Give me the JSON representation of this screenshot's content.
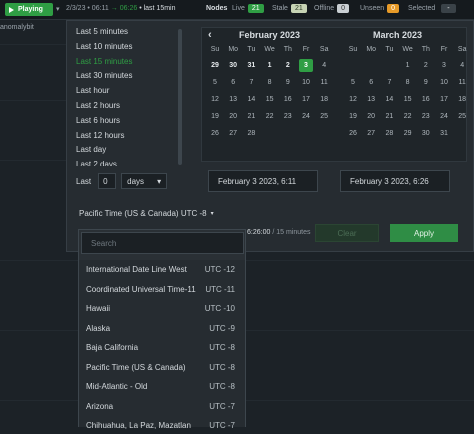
{
  "topbar": {
    "play_label": "Playing",
    "range_start": "2/3/23 • 06:11",
    "arrow": "→",
    "range_end": "06:26",
    "range_suffix": "• last 15min",
    "nodes_label": "Nodes",
    "live_label": "Live",
    "live_count": "21",
    "stale_label": "Stale",
    "stale_count": "21",
    "offline_label": "Offline",
    "offline_count": "0",
    "unseen_label": "Unseen",
    "unseen_count": "0",
    "selected_label": "Selected",
    "selected_count": "-",
    "colors": {
      "live": "#2f9e44",
      "stale": "#7a8a6a",
      "offline": "#6b747b",
      "unseen": "#e69a28"
    }
  },
  "left_strip": {
    "label": "anomalybit"
  },
  "quick_ranges": [
    "Last 5 minutes",
    "Last 10 minutes",
    "Last 15 minutes",
    "Last 30 minutes",
    "Last hour",
    "Last 2 hours",
    "Last 6 hours",
    "Last 12 hours",
    "Last day",
    "Last 2 days"
  ],
  "active_quick_range_index": 2,
  "custom_last": {
    "label": "Last",
    "value": "0",
    "unit": "days",
    "caret": "▾"
  },
  "timezone": {
    "selected": "Pacific Time (US & Canada) UTC -8",
    "caret": "▾"
  },
  "calendar_left": {
    "title": "February 2023",
    "prev_icon": "‹",
    "days_of_week": [
      "Su",
      "Mo",
      "Tu",
      "We",
      "Th",
      "Fr",
      "Sa"
    ],
    "weeks": [
      [
        "29",
        "30",
        "31",
        "1",
        "2",
        "3",
        "4"
      ],
      [
        "5",
        "6",
        "7",
        "8",
        "9",
        "10",
        "11"
      ],
      [
        "12",
        "13",
        "14",
        "15",
        "16",
        "17",
        "18"
      ],
      [
        "19",
        "20",
        "21",
        "22",
        "23",
        "24",
        "25"
      ],
      [
        "26",
        "27",
        "28",
        "",
        "",
        "",
        ""
      ]
    ],
    "selected_day": "3"
  },
  "calendar_right": {
    "title": "March 2023",
    "days_of_week": [
      "Su",
      "Mo",
      "Tu",
      "We",
      "Th",
      "Fr",
      "Sa"
    ],
    "weeks": [
      [
        "",
        "",
        "",
        "1",
        "2",
        "3",
        "4"
      ],
      [
        "5",
        "6",
        "7",
        "8",
        "9",
        "10",
        "11"
      ],
      [
        "12",
        "13",
        "14",
        "15",
        "16",
        "17",
        "18"
      ],
      [
        "19",
        "20",
        "21",
        "22",
        "23",
        "24",
        "25"
      ],
      [
        "26",
        "27",
        "28",
        "29",
        "30",
        "31",
        ""
      ]
    ]
  },
  "start_datetime": "February 3 2023, 6:11",
  "end_datetime": "February 3 2023, 6:26",
  "duration": {
    "time": "6:26:00",
    "separator": "/",
    "span": "15 minutes"
  },
  "buttons": {
    "clear": "Clear",
    "apply": "Apply"
  },
  "tz_dropdown": {
    "search_placeholder": "Search",
    "options": [
      {
        "name": "International Date Line West",
        "offset": "UTC -12"
      },
      {
        "name": "Coordinated Universal Time-11",
        "offset": "UTC -11"
      },
      {
        "name": "Hawaii",
        "offset": "UTC -10"
      },
      {
        "name": "Alaska",
        "offset": "UTC -9"
      },
      {
        "name": "Baja California",
        "offset": "UTC -8"
      },
      {
        "name": "Pacific Time (US & Canada)",
        "offset": "UTC -8"
      },
      {
        "name": "Mid-Atlantic - Old",
        "offset": "UTC -8"
      },
      {
        "name": "Arizona",
        "offset": "UTC -7"
      },
      {
        "name": "Chihuahua, La Paz, Mazatlan",
        "offset": "UTC -7"
      }
    ]
  }
}
